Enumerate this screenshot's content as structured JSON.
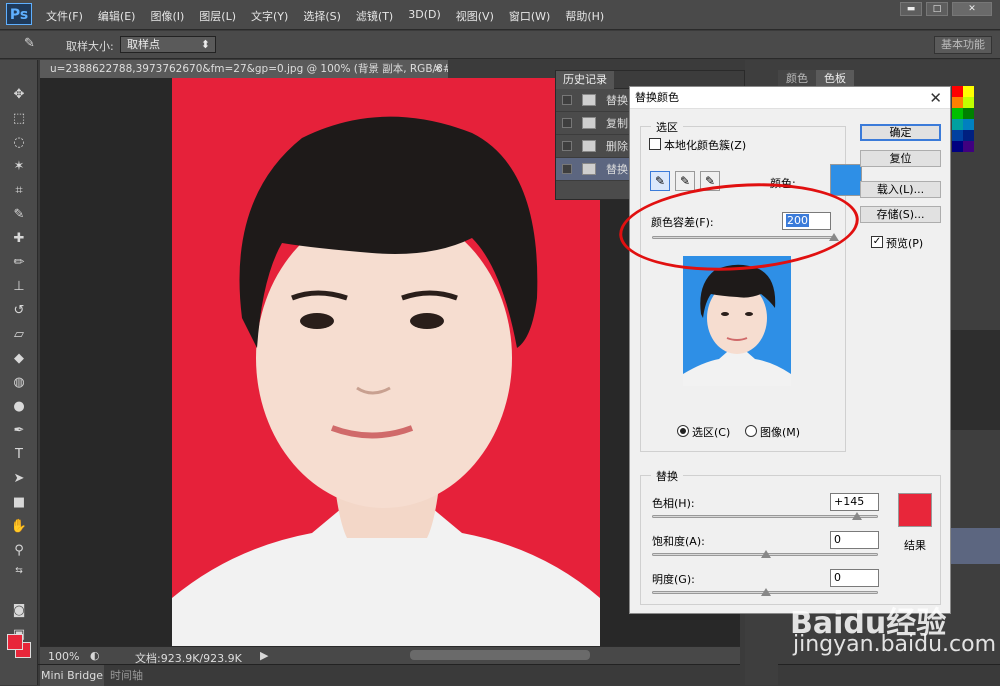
{
  "app": {
    "logo": "Ps"
  },
  "menu": [
    "文件(F)",
    "编辑(E)",
    "图像(I)",
    "图层(L)",
    "文字(Y)",
    "选择(S)",
    "滤镜(T)",
    "3D(D)",
    "视图(V)",
    "窗口(W)",
    "帮助(H)"
  ],
  "options": {
    "sample_size_label": "取样大小:",
    "sample_size_value": "取样点",
    "workspace": "基本功能"
  },
  "document": {
    "tab_title": "u=2388622788,3973762670&fm=27&gp=0.jpg @ 100% (背景 副本, RGB/8#) *",
    "zoom": "100%",
    "doc_size": "文档:923.9K/923.9K"
  },
  "bottom_tabs": [
    "Mini Bridge",
    "时间轴"
  ],
  "right_panel_tabs": [
    "颜色",
    "色板"
  ],
  "history": {
    "tab": "历史记录",
    "items": [
      "替换",
      "复制",
      "删除",
      "替换"
    ]
  },
  "swatch_colors": [
    "#ff0000",
    "#ffff00",
    "#ff8000",
    "#c0ff00",
    "#00c000",
    "#008000",
    "#00a0a0",
    "#0080c0",
    "#0040a0",
    "#002080",
    "#000080",
    "#400080"
  ],
  "dialog": {
    "title": "替换颜色",
    "selection_group": "选区",
    "localized_clusters": "本地化颜色簇(Z)",
    "color_label": "颜色:",
    "selection_color": "#2e8fe6",
    "fuzziness_label": "颜色容差(F):",
    "fuzziness_value": "200",
    "fuzziness_level": 200,
    "fuzziness_max": 200,
    "radio_selection": "选区(C)",
    "radio_image": "图像(M)",
    "replace_group": "替换",
    "hue_label": "色相(H):",
    "hue_value": "+145",
    "saturation_label": "饱和度(A):",
    "saturation_value": "0",
    "lightness_label": "明度(G):",
    "lightness_value": "0",
    "result_label": "结果",
    "result_color": "#e8263a",
    "ok": "确定",
    "reset": "复位",
    "load": "载入(L)...",
    "save": "存储(S)...",
    "preview": "预览(P)"
  },
  "watermark": {
    "brand": "Baidu经验",
    "url": "jingyan.baidu.com"
  }
}
